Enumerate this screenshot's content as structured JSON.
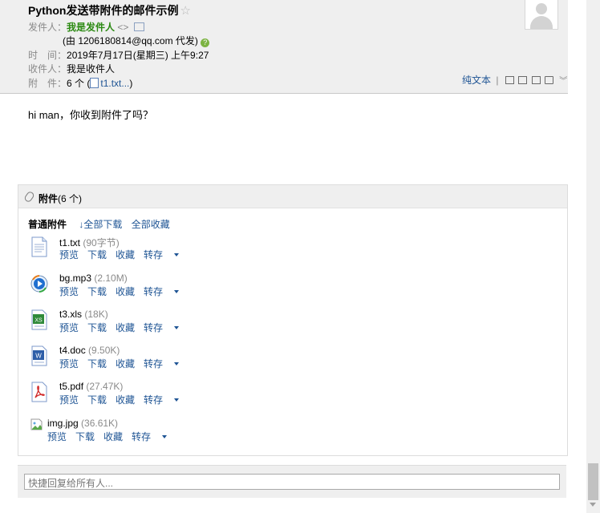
{
  "header": {
    "subject": "Python发送带附件的邮件示例",
    "star": "☆",
    "from_label": "发件人：",
    "from_name": "我是发件人",
    "from_addr": "<>",
    "proxy_text": "(由 1206180814@qq.com 代发)",
    "time_label": "时　间：",
    "time_value": "2019年7月17日(星期三) 上午9:27",
    "to_label": "收件人：",
    "to_value": "我是收件人",
    "att_label": "附　件：",
    "att_count": "6 个 (",
    "att_first": "t1.txt...",
    "att_close": ")",
    "plain_text": "纯文本",
    "sep": "|"
  },
  "body": {
    "text": "hi man，你收到附件了吗？"
  },
  "attachments": {
    "title": "附件",
    "count": "(6 个)",
    "type_label": "普通附件",
    "download_all": "全部下载",
    "save_all": "全部收藏",
    "items": [
      {
        "name": "t1.txt",
        "size": "(90字节)",
        "icon": "txt-file-icon",
        "color": "#5b7fb8"
      },
      {
        "name": "bg.mp3",
        "size": "(2.10M)",
        "icon": "media-player-icon",
        "color": "#1a6fd0"
      },
      {
        "name": "t3.xls",
        "size": "(18K)",
        "icon": "excel-file-icon",
        "color": "#2f8a3a"
      },
      {
        "name": "t4.doc",
        "size": "(9.50K)",
        "icon": "word-file-icon",
        "color": "#2e5ea8"
      },
      {
        "name": "t5.pdf",
        "size": "(27.47K)",
        "icon": "pdf-file-icon",
        "color": "#d12a2a"
      },
      {
        "name": "img.jpg",
        "size": "(36.61K)",
        "icon": "broken-image-icon",
        "color": "#888888"
      }
    ],
    "actions": {
      "preview": "预览",
      "download": "下载",
      "favorite": "收藏",
      "save_to": "转存"
    }
  },
  "reply": {
    "placeholder": "快捷回复给所有人..."
  }
}
